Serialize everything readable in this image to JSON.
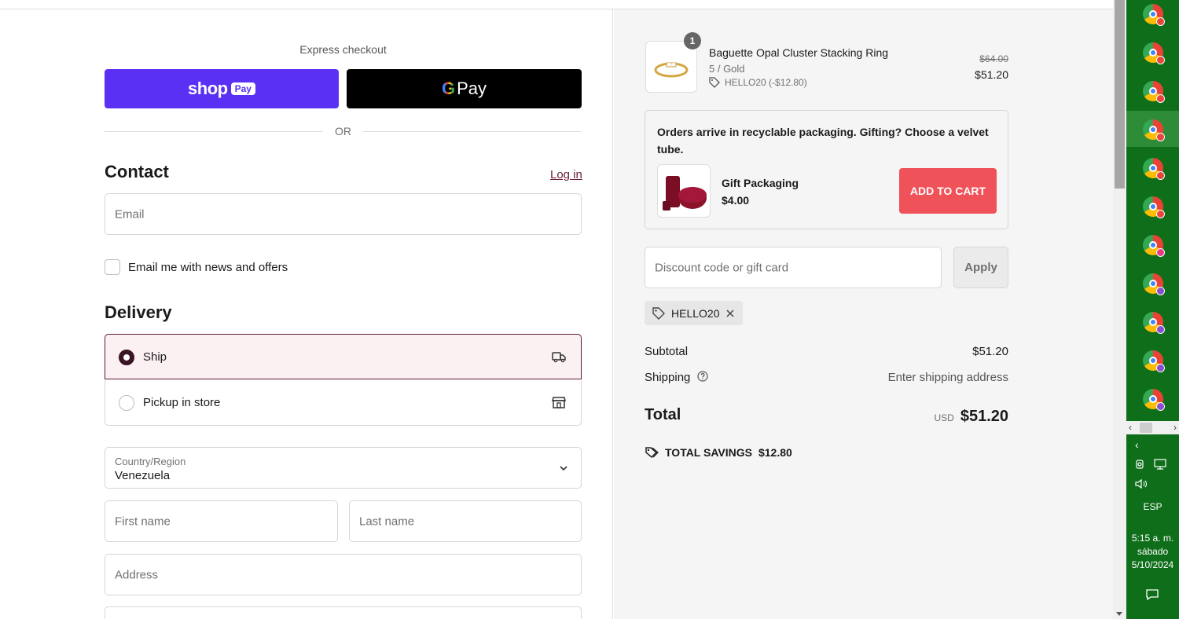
{
  "left": {
    "express_checkout": "Express checkout",
    "shop_pay": {
      "word": "shop",
      "badge": "Pay"
    },
    "gpay": {
      "g": "G",
      "word": "Pay"
    },
    "or": "OR",
    "contact_heading": "Contact",
    "login": "Log in",
    "email_placeholder": "Email",
    "newsletter_label": "Email me with news and offers",
    "delivery_heading": "Delivery",
    "options": [
      {
        "label": "Ship",
        "selected": true,
        "icon": "truck-icon"
      },
      {
        "label": "Pickup in store",
        "selected": false,
        "icon": "store-icon"
      }
    ],
    "country_caption": "Country/Region",
    "country_value": "Venezuela",
    "first_name_placeholder": "First name",
    "last_name_placeholder": "Last name",
    "address_placeholder": "Address"
  },
  "summary": {
    "quantity": "1",
    "product_name": "Baguette Opal Cluster Stacking Ring",
    "variant": "5 / Gold",
    "discount_tag": "HELLO20 (-$12.80)",
    "old_price": "$64.00",
    "new_price": "$51.20",
    "upsell_text": "Orders arrive in recyclable packaging. Gifting? Choose a velvet tube.",
    "gift_name": "Gift Packaging",
    "gift_price": "$4.00",
    "add_to_cart": "ADD TO CART",
    "discount_placeholder": "Discount code or gift card",
    "apply": "Apply",
    "applied_code": "HELLO20",
    "subtotal_label": "Subtotal",
    "subtotal_value": "$51.20",
    "shipping_label": "Shipping",
    "shipping_value": "Enter shipping address",
    "total_label": "Total",
    "currency": "USD",
    "total_value": "$51.20",
    "savings_label": "TOTAL SAVINGS",
    "savings_value": "$12.80"
  },
  "taskbar": {
    "language": "ESP",
    "time": "5:15 a. m.",
    "day": "sábado",
    "date": "5/10/2024",
    "badge_colors": [
      "#e8453c",
      "#e8453c",
      "#e8453c",
      "#e8453c",
      "#e8453c",
      "#e8453c",
      "#e83a8c",
      "#8a4fd1",
      "#8a4fd1",
      "#8a4fd1",
      "#8a4fd1"
    ]
  },
  "colors": {
    "shop_pay": "#5a31f4",
    "accent": "#5c1a33",
    "add_to_cart": "#ef5259",
    "taskbar": "#0f6e1a"
  }
}
